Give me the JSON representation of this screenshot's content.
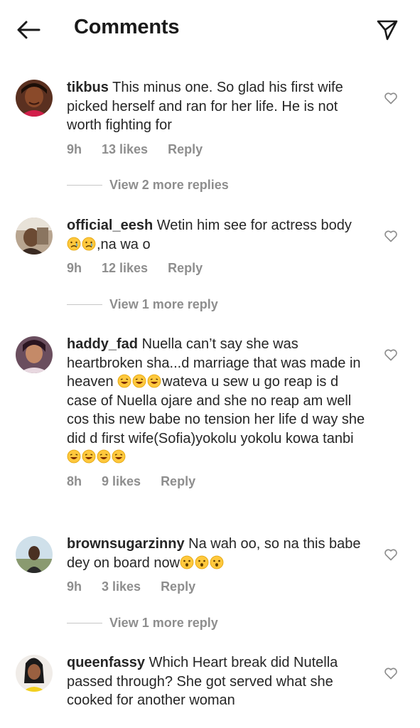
{
  "header": {
    "title": "Comments",
    "back_icon": "arrow-left-icon",
    "send_icon": "send-icon"
  },
  "colors": {
    "text": "#262626",
    "secondary": "#8e8e8e",
    "divider": "#c7c7c7"
  },
  "comments": [
    {
      "username": "tikbus",
      "text": "This minus one. So glad his first wife picked herself and ran for her life. He is not worth fighting for",
      "time": "9h",
      "likes": "13 likes",
      "reply": "Reply",
      "view_replies": "View 2 more replies"
    },
    {
      "username": "official_eesh",
      "text_parts": [
        "Wetin him see for actress body",
        ",na wa o"
      ],
      "time": "9h",
      "likes": "12 likes",
      "reply": "Reply",
      "view_replies": "View 1 more reply"
    },
    {
      "username": "haddy_fad",
      "text_parts": [
        "Nuella can’t say she was heartbroken sha...d marriage that was made in heaven ",
        "wateva u sew u go reap is d case of Nuella ojare and she no reap am well cos this new babe no tension her life d way she did d first wife(Sofia)yokolu yokolu kowa tanbi "
      ],
      "time": "8h",
      "likes": "9 likes",
      "reply": "Reply"
    },
    {
      "username": "brownsugarzinny",
      "text_parts": [
        "Na wah oo, so na this babe dey on board now"
      ],
      "time": "9h",
      "likes": "3 likes",
      "reply": "Reply",
      "view_replies": "View 1 more reply"
    },
    {
      "username": "queenfassy",
      "text": "Which Heart break did Nutella passed through? She got served what she cooked for another woman"
    }
  ]
}
